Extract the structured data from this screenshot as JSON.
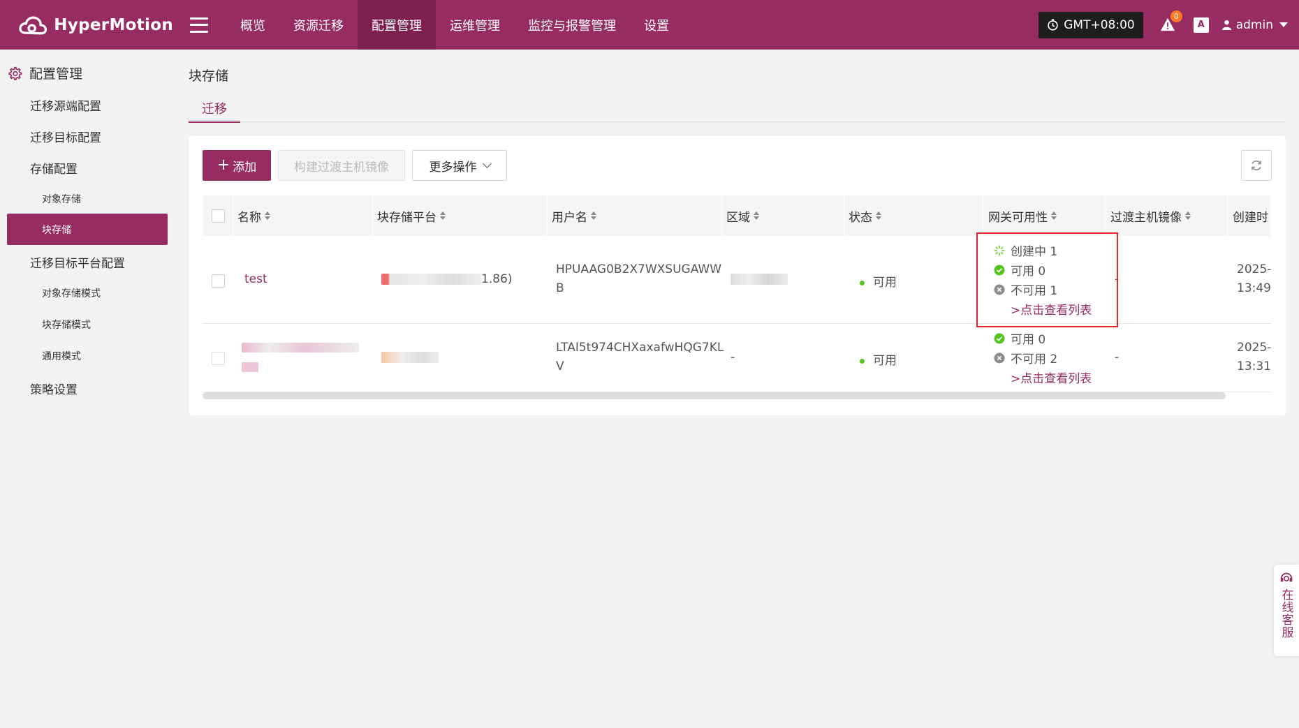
{
  "app": {
    "name": "HyperMotion"
  },
  "nav": {
    "items": [
      {
        "label": "概览"
      },
      {
        "label": "资源迁移"
      },
      {
        "label": "配置管理"
      },
      {
        "label": "运维管理"
      },
      {
        "label": "监控与报警管理"
      },
      {
        "label": "设置"
      }
    ],
    "active_index": 2
  },
  "header": {
    "timezone": "GMT+08:00",
    "alert_count": "0",
    "lang_label": "A",
    "user": "admin"
  },
  "sidebar": {
    "title": "配置管理",
    "items": [
      {
        "label": "迁移源端配置"
      },
      {
        "label": "迁移目标配置"
      },
      {
        "label": "存储配置"
      },
      {
        "label": "对象存储"
      },
      {
        "label": "块存储"
      },
      {
        "label": "迁移目标平台配置"
      },
      {
        "label": "对象存储模式"
      },
      {
        "label": "块存储模式"
      },
      {
        "label": "通用模式"
      },
      {
        "label": "策略设置"
      }
    ],
    "active_index": 4
  },
  "main": {
    "title": "块存储",
    "tab": "迁移",
    "toolbar": {
      "add": "添加",
      "build": "构建过渡主机镜像",
      "more": "更多操作"
    },
    "columns": [
      "名称",
      "块存储平台",
      "用户名",
      "区域",
      "状态",
      "网关可用性",
      "过渡主机镜像",
      "创建时"
    ],
    "rows": [
      {
        "name": "test",
        "platform_suffix": "1.86)",
        "username_line1": "HPUAAG0B2X7WXSUGAWW",
        "username_line2": "B",
        "region": "",
        "status": "可用",
        "gw_creating": "创建中 1",
        "gw_ok": "可用 0",
        "gw_bad": "不可用 1",
        "gw_link": ">点击查看列表",
        "image": "-",
        "created_line1": "2025-",
        "created_line2": "13:49:"
      },
      {
        "name_line1": "",
        "username_line1": "LTAI5t974CHXaxafwHQG7KL",
        "username_line2": "V",
        "region": "-",
        "status": "可用",
        "gw_ok": "可用 0",
        "gw_bad": "不可用 2",
        "gw_link": ">点击查看列表",
        "image": "-",
        "created_line1": "2025-",
        "created_line2": "13:31:"
      }
    ]
  },
  "service": {
    "label": "在线客服"
  },
  "colors": {
    "brand": "#962c62",
    "brand_dark": "#7d2050",
    "status_ok": "#52c41a",
    "highlight": "#e5242a"
  },
  "icons": [
    "cloud-logo-icon",
    "menu-icon",
    "clock-icon",
    "alert-icon",
    "translate-icon",
    "user-icon",
    "gear-icon",
    "refresh-icon",
    "spinner-icon",
    "check-circle-icon",
    "x-circle-icon",
    "headset-icon"
  ]
}
